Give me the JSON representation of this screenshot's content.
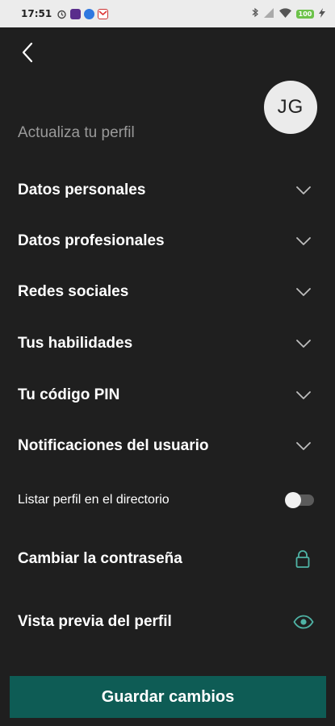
{
  "status_bar": {
    "time": "17:51",
    "battery": "100",
    "icons": [
      "alarm-icon",
      "app-notification-icon",
      "messenger-icon",
      "mail-icon",
      "bluetooth-icon",
      "signal-icon",
      "wifi-icon",
      "battery-icon",
      "charging-icon"
    ]
  },
  "header": {
    "back_icon": "chevron-left-icon",
    "avatar_initials": "JG",
    "title": "Actualiza tu perfil"
  },
  "sections": [
    {
      "label": "Datos personales",
      "icon": "chevron-down-icon"
    },
    {
      "label": "Datos profesionales",
      "icon": "chevron-down-icon"
    },
    {
      "label": "Redes sociales",
      "icon": "chevron-down-icon"
    },
    {
      "label": "Tus habilidades",
      "icon": "chevron-down-icon"
    },
    {
      "label": "Tu código PIN",
      "icon": "chevron-down-icon"
    },
    {
      "label": "Notificaciones del usuario",
      "icon": "chevron-down-icon"
    }
  ],
  "directory_toggle": {
    "label": "Listar perfil en el directorio",
    "enabled": false
  },
  "actions": {
    "change_password": {
      "label": "Cambiar la contraseña",
      "icon": "lock-icon"
    },
    "preview_profile": {
      "label": "Vista previa del perfil",
      "icon": "eye-icon"
    }
  },
  "save_button": {
    "label": "Guardar cambios"
  },
  "colors": {
    "background": "#1f1f1f",
    "accent": "#0e5c55",
    "icon_accent": "#4fb3a5",
    "muted_text": "#9a9a9a"
  }
}
